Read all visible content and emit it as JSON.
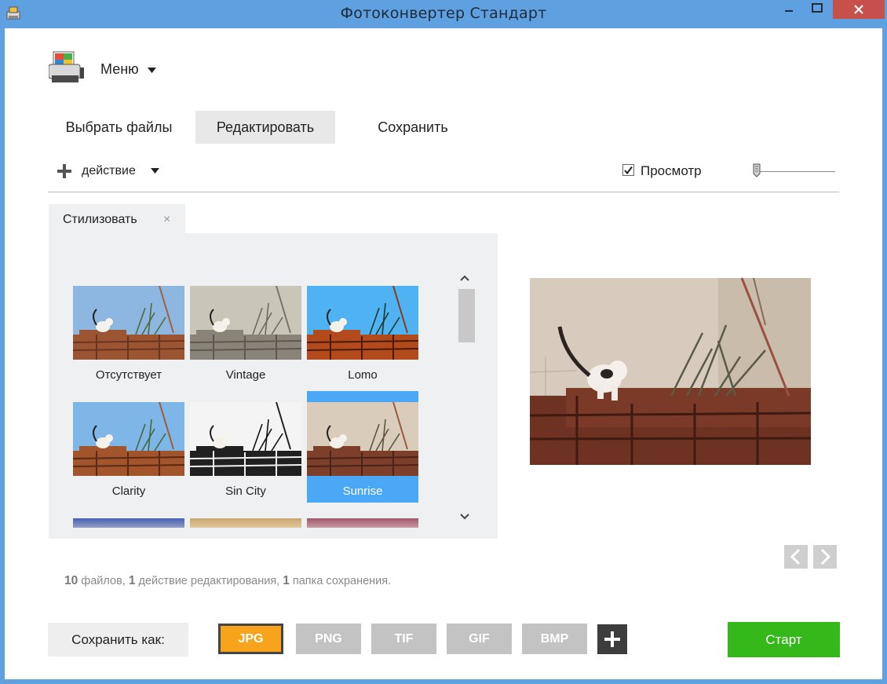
{
  "window": {
    "title": "Фотоконвертер Стандарт"
  },
  "menu": {
    "label": "Меню"
  },
  "tabs": [
    "Выбрать файлы",
    "Редактировать",
    "Сохранить"
  ],
  "toolbar": {
    "action_label": "действие",
    "preview_label": "Просмотр",
    "preview_checked": true
  },
  "panel": {
    "title": "Стилизовать",
    "close": "×",
    "styles": [
      "Отсутствует",
      "Vintage",
      "Lomo",
      "Clarity",
      "Sin City",
      "Sunrise"
    ],
    "selected": "Sunrise"
  },
  "stats": {
    "files_count": "10",
    "files_text": "файлов,",
    "actions_count": "1",
    "actions_text": "действие редактирования,",
    "folders_count": "1",
    "folders_text": "папка сохранения."
  },
  "save": {
    "label": "Сохранить как:",
    "formats": [
      "JPG",
      "PNG",
      "TIF",
      "GIF",
      "BMP"
    ],
    "active_format": "JPG"
  },
  "start_label": "Старт",
  "colors": {
    "accent_blue": "#4aa8f6",
    "jpg_orange": "#f7a41c",
    "start_green": "#35b819",
    "titlebar": "#5fa0e0"
  }
}
